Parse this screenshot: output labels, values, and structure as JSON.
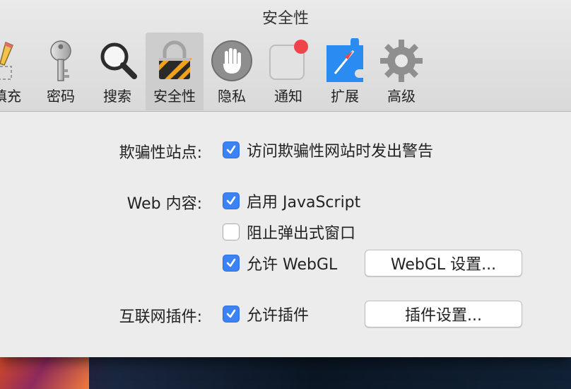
{
  "window": {
    "title": "安全性"
  },
  "toolbar": {
    "tabs": [
      {
        "id": "autofill",
        "label": "填充",
        "icon": "pencil-icon"
      },
      {
        "id": "passwords",
        "label": "密码",
        "icon": "key-icon"
      },
      {
        "id": "search",
        "label": "搜索",
        "icon": "magnifier-icon"
      },
      {
        "id": "security",
        "label": "安全性",
        "icon": "lock-icon",
        "selected": true
      },
      {
        "id": "privacy",
        "label": "隐私",
        "icon": "hand-icon"
      },
      {
        "id": "notifications",
        "label": "通知",
        "icon": "notification-icon"
      },
      {
        "id": "extensions",
        "label": "扩展",
        "icon": "puzzle-compass-icon"
      },
      {
        "id": "advanced",
        "label": "高级",
        "icon": "gear-icon"
      }
    ]
  },
  "security": {
    "fraud": {
      "label": "欺骗性站点:",
      "option": {
        "label": "访问欺骗性网站时发出警告",
        "checked": true
      }
    },
    "web_content": {
      "label": "Web 内容:",
      "options": [
        {
          "label": "启用 JavaScript",
          "checked": true
        },
        {
          "label": "阻止弹出式窗口",
          "checked": false
        },
        {
          "label": "允许 WebGL",
          "checked": true
        }
      ],
      "webgl_button": "WebGL 设置..."
    },
    "plugins": {
      "label": "互联网插件:",
      "option": {
        "label": "允许插件",
        "checked": true
      },
      "button": "插件设置..."
    }
  },
  "colors": {
    "accent": "#3b82f6",
    "window_bg": "#ececec"
  }
}
